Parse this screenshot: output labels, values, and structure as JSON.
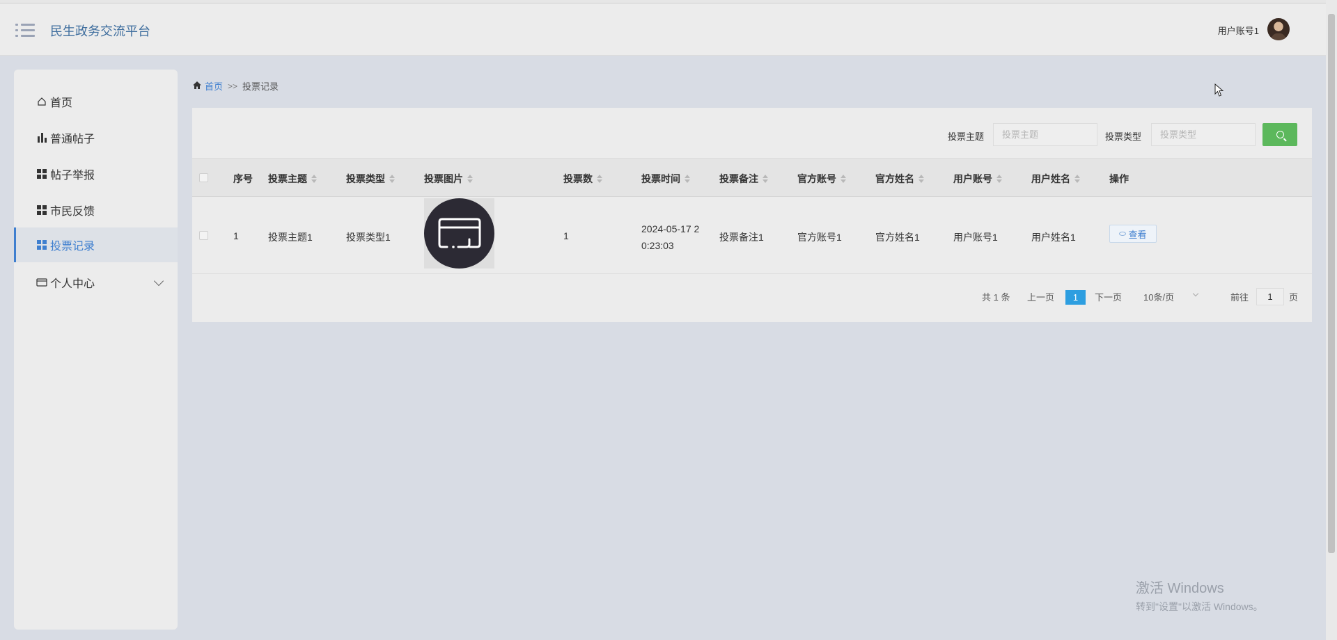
{
  "header": {
    "app_title": "民生政务交流平台",
    "user_name": "用户账号1"
  },
  "sidebar": {
    "items": [
      {
        "label": "首页",
        "icon": "home-icon"
      },
      {
        "label": "普通帖子",
        "icon": "bar-chart-icon"
      },
      {
        "label": "帖子举报",
        "icon": "grid-icon"
      },
      {
        "label": "市民反馈",
        "icon": "grid-icon"
      },
      {
        "label": "投票记录",
        "icon": "grid-icon",
        "active": true
      },
      {
        "label": "个人中心",
        "icon": "wallet-icon",
        "expandable": true
      }
    ]
  },
  "breadcrumb": {
    "home": "首页",
    "separator": ">>",
    "current": "投票记录"
  },
  "filters": {
    "topic_label": "投票主题",
    "topic_placeholder": "投票主题",
    "type_label": "投票类型",
    "type_placeholder": "投票类型"
  },
  "table": {
    "headers": [
      "序号",
      "投票主题",
      "投票类型",
      "投票图片",
      "投票数",
      "投票时间",
      "投票备注",
      "官方账号",
      "官方姓名",
      "用户账号",
      "用户姓名",
      "操作"
    ],
    "rows": [
      {
        "index": "1",
        "topic": "投票主题1",
        "type": "投票类型1",
        "count": "1",
        "time": "2024-05-17 20:23:03",
        "remark": "投票备注1",
        "official_account": "官方账号1",
        "official_name": "官方姓名1",
        "user_account": "用户账号1",
        "user_name": "用户姓名1",
        "action": "查看"
      }
    ]
  },
  "pagination": {
    "total": "共 1 条",
    "prev": "上一页",
    "current_page": "1",
    "next": "下一页",
    "page_size": "10条/页",
    "goto_label": "前往",
    "goto_value": "1",
    "goto_suffix": "页"
  },
  "watermark": {
    "line1": "激活 Windows",
    "line2": "转到\"设置\"以激活 Windows。"
  },
  "colors": {
    "accent": "#3f7fcf",
    "search_button": "#5cb85c",
    "active_page": "#2d9ee0"
  }
}
